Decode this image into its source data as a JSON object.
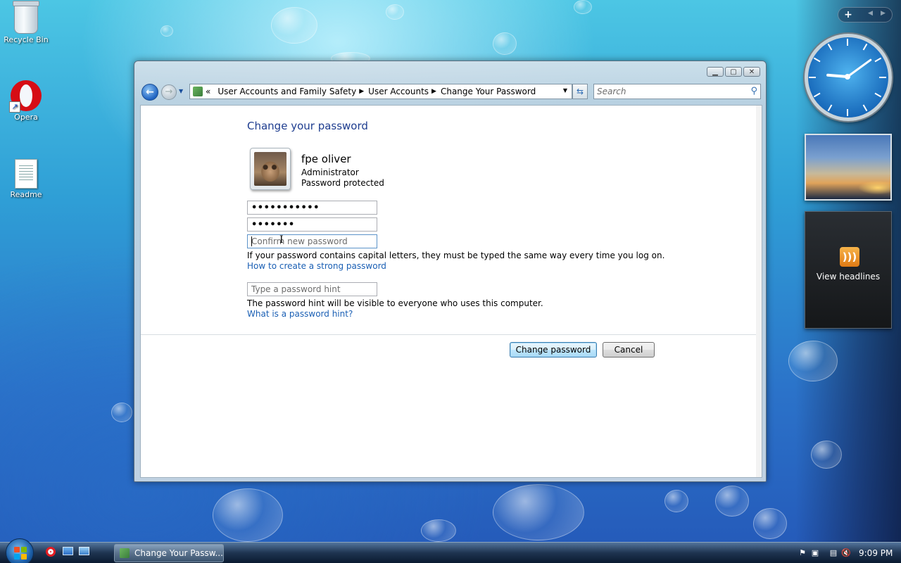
{
  "desktop": {
    "icons": [
      {
        "label": "Recycle Bin"
      },
      {
        "label": "Opera"
      },
      {
        "label": "Readme"
      }
    ]
  },
  "window": {
    "address": {
      "overflow": "«",
      "crumbs": [
        "User Accounts and Family Safety",
        "User Accounts",
        "Change Your Password"
      ]
    },
    "search": {
      "placeholder": "Search"
    },
    "heading": "Change your password",
    "user": {
      "name": "fpe oliver",
      "role": "Administrator",
      "status": "Password protected"
    },
    "form": {
      "current_password": "•••••••••••",
      "new_password": "•••••••",
      "confirm_placeholder": "Confirm new password",
      "capital_note": "If your password contains capital letters, they must be typed the same way every time you log on.",
      "strong_link": "How to create a strong password",
      "hint_placeholder": "Type a password hint",
      "hint_note": "The password hint will be visible to everyone who uses this computer.",
      "hint_link": "What is a password hint?"
    },
    "buttons": {
      "change": "Change password",
      "cancel": "Cancel"
    }
  },
  "gadgets": {
    "clock": {
      "hour": 9,
      "minute": 9
    },
    "headlines_label": "View headlines"
  },
  "taskbar": {
    "task_label": "Change Your Passw...",
    "time": "9:09 PM"
  },
  "colors": {
    "link": "#1a5fb4",
    "heading": "#1e3d8f"
  }
}
